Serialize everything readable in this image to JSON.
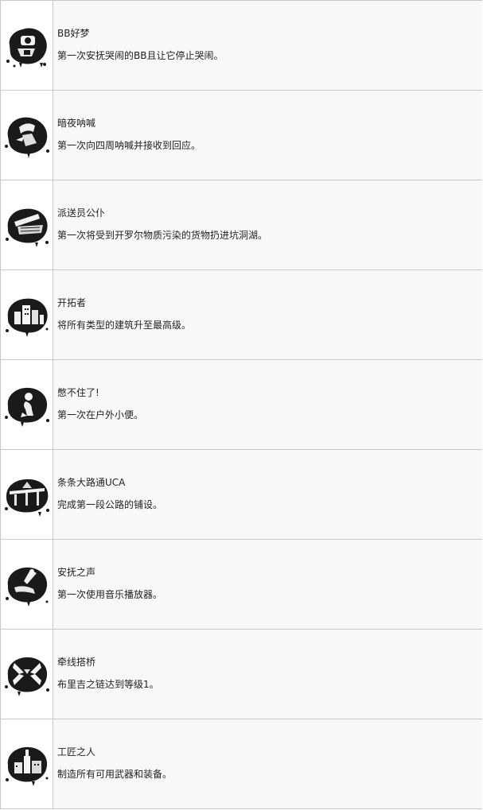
{
  "achievements": [
    {
      "icon": "baby-pod-icon",
      "title": "BB好梦",
      "description": "第一次安抚哭闹的BB且让它停止哭闹。"
    },
    {
      "icon": "shouting-figure-icon",
      "title": "暗夜呐喊",
      "description": "第一次向四周呐喊并接收到回应。"
    },
    {
      "icon": "porter-ship-icon",
      "title": "派送员公仆",
      "description": "第一次将受到开罗尔物质污染的货物扔进坑洞湖。"
    },
    {
      "icon": "city-buildings-icon",
      "title": "开拓者",
      "description": "将所有类型的建筑升至最高级。"
    },
    {
      "icon": "kneeling-figure-icon",
      "title": "憋不住了!",
      "description": "第一次在户外小便。"
    },
    {
      "icon": "highway-bridge-icon",
      "title": "条条大路通UCA",
      "description": "完成第一段公路的铺设。"
    },
    {
      "icon": "music-player-icon",
      "title": "安抚之声",
      "description": "第一次使用音乐播放器。"
    },
    {
      "icon": "bridges-logo-icon",
      "title": "牵线搭桥",
      "description": "布里吉之链达到等级1。"
    },
    {
      "icon": "craftsman-ruins-icon",
      "title": "工匠之人",
      "description": "制造所有可用武器和装备。"
    }
  ]
}
